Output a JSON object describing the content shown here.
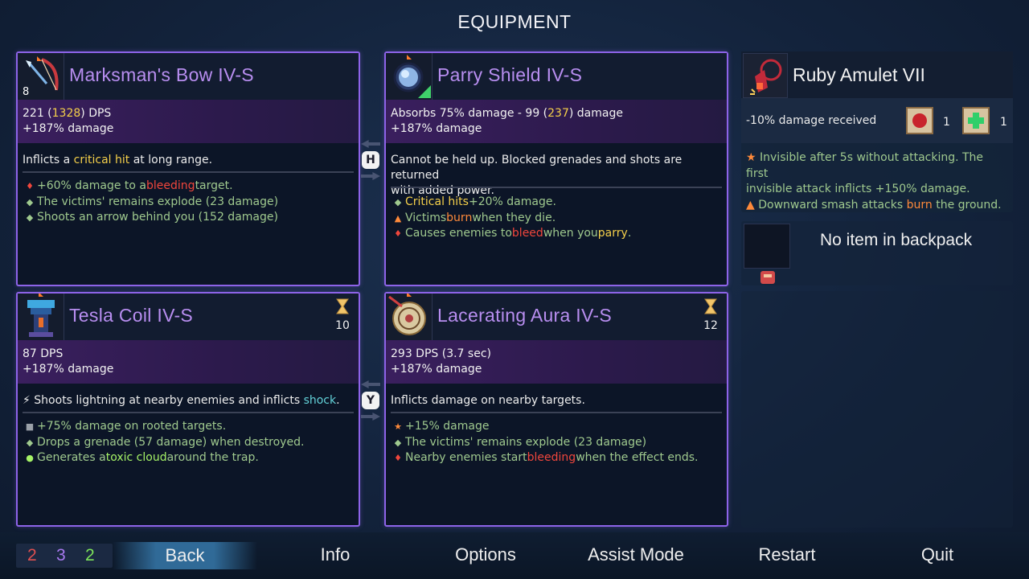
{
  "title": "EQUIPMENT",
  "cards": {
    "bow": {
      "name": "Marksman's Bow IV-S",
      "level": "8",
      "dps": "221 (",
      "dps_alt": "1328",
      "dps_suffix": ") DPS",
      "damage_bonus": "+187% damage",
      "desc_pre": "Inflicts a ",
      "desc_hl": "critical hit",
      "desc_post": " at long range.",
      "affixes": [
        {
          "icon": "blood-drop-icon",
          "pre": "+60% damage to a ",
          "hl": "bleeding",
          "post": " target."
        },
        {
          "icon": "diamond-bullet-icon",
          "pre": "The victims' remains explode (23 damage)",
          "hl": "",
          "post": ""
        },
        {
          "icon": "diamond-bullet-icon",
          "pre": "Shoots an arrow behind you (152 damage)",
          "hl": "",
          "post": ""
        }
      ]
    },
    "shield": {
      "name": "Parry Shield IV-S",
      "stat_pre": "Absorbs 75% damage - 99 (",
      "stat_alt": "237",
      "stat_post": ") damage",
      "damage_bonus": "+187% damage",
      "desc_line1": "Cannot be held up. Blocked grenades and shots are returned",
      "desc_line2": "with added power.",
      "affixes": [
        {
          "icon": "diamond-bullet-icon",
          "hl": "Critical hits",
          "post": " +20% damage."
        },
        {
          "icon": "flame-icon",
          "pre": "Victims ",
          "hl": "burn",
          "post": " when they die."
        },
        {
          "icon": "blood-drop-icon",
          "pre": "Causes enemies to ",
          "hl": "bleed",
          "mid": " when you ",
          "hl2": "parry",
          "post": "."
        }
      ]
    },
    "tesla": {
      "name": "Tesla Coil IV-S",
      "timer": "10",
      "dps": "87 DPS",
      "damage_bonus": "+187% damage",
      "desc_pre": "Shoots lightning at nearby enemies and inflicts ",
      "desc_hl": "shock",
      "desc_post": ".",
      "affixes": [
        {
          "icon": "lock-icon",
          "pre": "+75% damage on rooted targets."
        },
        {
          "icon": "diamond-bullet-icon",
          "pre": "Drops a grenade (57 damage) when destroyed."
        },
        {
          "icon": "toxic-cloud-icon",
          "pre": "Generates a ",
          "hl": "toxic cloud",
          "post": " around the trap."
        }
      ]
    },
    "aura": {
      "name": "Lacerating Aura IV-S",
      "timer": "12",
      "dps": "293 DPS (3.7 sec)",
      "damage_bonus": "+187% damage",
      "desc": "Inflicts damage on nearby targets.",
      "affixes": [
        {
          "icon": "star-icon",
          "pre": "+15% damage"
        },
        {
          "icon": "diamond-bullet-icon",
          "pre": "The victims' remains explode (23 damage)"
        },
        {
          "icon": "blood-drop-icon",
          "pre": "Nearby enemies start ",
          "hl": "bleeding",
          "post": " when the effect ends."
        }
      ]
    }
  },
  "keys": {
    "swap_top": "H",
    "swap_bottom": "Y"
  },
  "amulet": {
    "name": "Ruby Amulet VII",
    "stat": "-10% damage received",
    "scroll_red_count": "1",
    "scroll_green_count": "1",
    "affix1": "Invisible after 5s without attacking. The first invisible attack inflicts +150% damage.",
    "affix1_line1": "Invisible after 5s without attacking. The first",
    "affix1_line2": "invisible attack inflicts +150% damage.",
    "affix2_pre": "Downward smash attacks ",
    "affix2_hl": "burn",
    "affix2_post": " the ground."
  },
  "backpack": {
    "text": "No item in backpack"
  },
  "counters": {
    "red": "2",
    "purple": "3",
    "green": "2"
  },
  "menu": {
    "back": "Back",
    "info": "Info",
    "options": "Options",
    "assist": "Assist Mode",
    "restart": "Restart",
    "quit": "Quit"
  },
  "colors": {
    "card_border": "#8d63e8",
    "item_name": "#b88ef0",
    "highlight_yellow": "#f5d04a",
    "highlight_red": "#f0463c",
    "highlight_orange": "#ff8a3a",
    "highlight_green": "#a5f266",
    "highlight_cyan": "#63d2d9",
    "affix_text": "#9fc98e",
    "counter_red": "#e05050",
    "counter_purple": "#a879ef",
    "counter_green": "#7de35a"
  }
}
